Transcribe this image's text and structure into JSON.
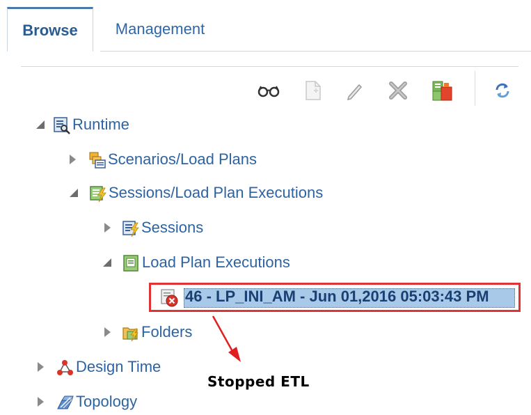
{
  "tabs": [
    {
      "label": "Browse",
      "active": true
    },
    {
      "label": "Management",
      "active": false
    }
  ],
  "toolbar": {
    "buttons": [
      {
        "icon": "view-glasses-icon"
      },
      {
        "icon": "new-document-icon"
      },
      {
        "icon": "edit-pencil-icon"
      },
      {
        "icon": "delete-x-icon"
      },
      {
        "icon": "run-operation-icon"
      },
      {
        "icon": "refresh-icon"
      }
    ]
  },
  "tree": {
    "runtime": {
      "label": "Runtime",
      "icon": "runtime-icon",
      "expanded": true
    },
    "scenarios": {
      "label": "Scenarios/Load Plans",
      "icon": "scenarios-icon",
      "expanded": false
    },
    "sessions_executions": {
      "label": "Sessions/Load Plan Executions",
      "icon": "sessions-executions-icon",
      "expanded": true
    },
    "sessions": {
      "label": "Sessions",
      "icon": "sessions-icon",
      "expanded": false
    },
    "load_plan_executions": {
      "label": "Load Plan Executions",
      "icon": "load-plan-executions-icon",
      "expanded": true
    },
    "execution_item": {
      "label": "46 - LP_INI_AM - Jun 01,2016 05:03:43 PM",
      "icon": "stopped-execution-icon",
      "selected": true
    },
    "folders": {
      "label": "Folders",
      "icon": "folders-icon",
      "expanded": false
    },
    "design_time": {
      "label": "Design Time",
      "icon": "design-time-icon",
      "expanded": false
    },
    "topology": {
      "label": "Topology",
      "icon": "topology-icon",
      "expanded": false
    }
  },
  "annotation": {
    "text": "Stopped ETL"
  },
  "colors": {
    "link": "#2c63a3",
    "highlight": "#e03333",
    "selection": "#a9c9e8"
  }
}
